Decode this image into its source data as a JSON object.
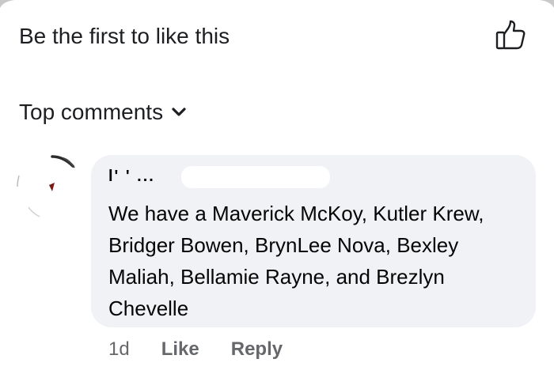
{
  "likes": {
    "text": "Be the first to like this",
    "icon": "thumbs-up-icon"
  },
  "comments_sort": {
    "label": "Top comments",
    "icon": "chevron-down-icon"
  },
  "comment": {
    "author_visible": "l' ' ...",
    "text": "We have a Maverick McKoy, Kutler Krew, Bridger Bowen, BrynLee Nova, Bexley Maliah, Bellamie Rayne, and Brezlyn Chevelle",
    "timestamp": "1d",
    "actions": {
      "like": "Like",
      "reply": "Reply"
    }
  },
  "colors": {
    "background": "#ffffff",
    "bubble": "#f0f2f5",
    "text": "#1c1e21",
    "secondary_text": "#65676b"
  }
}
